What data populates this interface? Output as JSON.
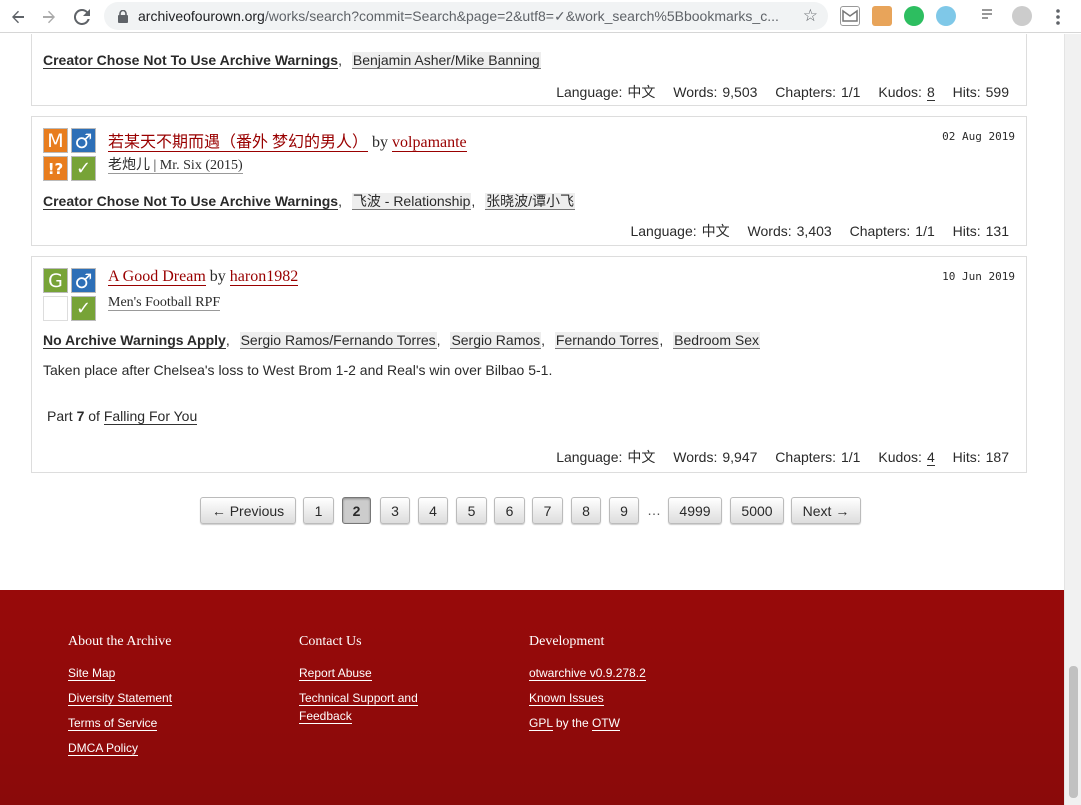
{
  "browser": {
    "url_host": "archiveofourown.org",
    "url_path": "/works/search?commit=Search&page=2&utf8=✓&work_search%5Bbookmarks_c..."
  },
  "work1_partial": {
    "warning": "Creator Chose Not To Use Archive Warnings",
    "tags": [
      "Benjamin Asher/Mike Banning"
    ],
    "stats": {
      "language_label": "Language:",
      "language": "中文",
      "words_label": "Words:",
      "words": "9,503",
      "chapters_label": "Chapters:",
      "chapters": "1/1",
      "kudos_label": "Kudos:",
      "kudos": "8",
      "hits_label": "Hits:",
      "hits": "599"
    }
  },
  "work2": {
    "rating_icon": "M",
    "category_icon": "♂",
    "warning_icon": "!?",
    "complete_icon": "✓",
    "title": "若某天不期而遇（番外 梦幻的男人）",
    "by": "by",
    "author": "volpamante",
    "fandom": "老炮儿 | Mr. Six (2015)",
    "date": "02 Aug 2019",
    "warning": "Creator Chose Not To Use Archive Warnings",
    "tags": [
      "飞波 - Relationship",
      "张晓波/谭小飞"
    ],
    "stats": {
      "language_label": "Language:",
      "language": "中文",
      "words_label": "Words:",
      "words": "3,403",
      "chapters_label": "Chapters:",
      "chapters": "1/1",
      "hits_label": "Hits:",
      "hits": "131"
    }
  },
  "work3": {
    "rating_icon": "G",
    "category_icon": "♂",
    "complete_icon": "✓",
    "title": "A Good Dream",
    "by": "by",
    "author": "haron1982",
    "fandom": "Men's Football RPF",
    "date": "10 Jun 2019",
    "warning": "No Archive Warnings Apply",
    "tags": [
      "Sergio Ramos/Fernando Torres",
      "Sergio Ramos",
      "Fernando Torres",
      "Bedroom Sex"
    ],
    "summary": "Taken place after Chelsea's loss to West Brom 1-2 and Real's win over Bilbao 5-1.",
    "series_part": "Part",
    "series_num": "7",
    "series_of": "of",
    "series_name": "Falling For You",
    "stats": {
      "language_label": "Language:",
      "language": "中文",
      "words_label": "Words:",
      "words": "9,947",
      "chapters_label": "Chapters:",
      "chapters": "1/1",
      "kudos_label": "Kudos:",
      "kudos": "4",
      "hits_label": "Hits:",
      "hits": "187"
    }
  },
  "pagination": {
    "previous": "← Previous",
    "pages": [
      "1",
      "2",
      "3",
      "4",
      "5",
      "6",
      "7",
      "8",
      "9"
    ],
    "gap": "…",
    "last_pages": [
      "4999",
      "5000"
    ],
    "next": "Next →",
    "current": "2"
  },
  "footer": {
    "about": {
      "heading": "About the Archive",
      "links": [
        "Site Map",
        "Diversity Statement",
        "Terms of Service",
        "DMCA Policy"
      ]
    },
    "contact": {
      "heading": "Contact Us",
      "links": [
        "Report Abuse",
        "Technical Support and Feedback"
      ]
    },
    "development": {
      "heading": "Development",
      "version": "otwarchive v0.9.278.2",
      "known_issues": "Known Issues",
      "gpl": "GPL",
      "by_the": "by the",
      "otw": "OTW"
    }
  },
  "colors": {
    "ao3_red": "#990000",
    "rating_m": "#e87d1e",
    "rating_g": "#77a337",
    "category": "#2d6fb7",
    "complete": "#77a337",
    "warning_unspec": "#e87d1e"
  }
}
